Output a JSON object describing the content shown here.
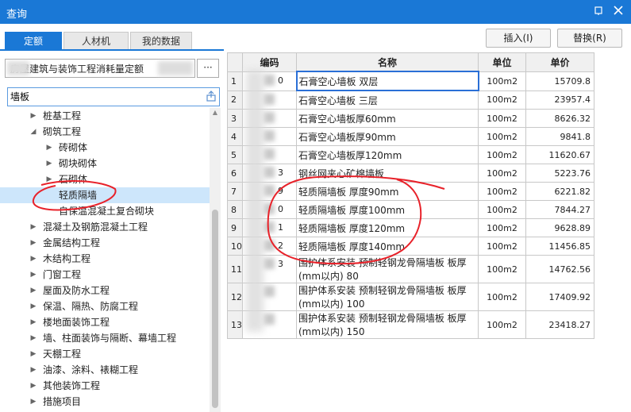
{
  "window": {
    "title": "查询",
    "pin_icon": "pin-icon",
    "close_icon": "close-icon"
  },
  "tabs": [
    {
      "label": "定额",
      "active": true
    },
    {
      "label": "人材机",
      "active": false
    },
    {
      "label": "我的数据",
      "active": false
    }
  ],
  "buttons": {
    "insert": "插入(I)",
    "replace": "替换(R)"
  },
  "library": {
    "text": "房屋建筑与装饰工程消耗量定额",
    "more": "···"
  },
  "search": {
    "value": "墙板",
    "icon": "export-icon"
  },
  "tree": [
    {
      "label": "桩基工程",
      "level": 1,
      "arrow": "▶"
    },
    {
      "label": "砌筑工程",
      "level": 1,
      "arrow": "◢"
    },
    {
      "label": "砖砌体",
      "level": 2,
      "arrow": "▶"
    },
    {
      "label": "砌块砌体",
      "level": 2,
      "arrow": "▶"
    },
    {
      "label": "石砌体",
      "level": 2,
      "arrow": "▶"
    },
    {
      "label": "轻质隔墙",
      "level": 2,
      "arrow": "",
      "selected": true
    },
    {
      "label": "自保温混凝土复合砌块",
      "level": 2,
      "arrow": ""
    },
    {
      "label": "混凝土及钢筋混凝土工程",
      "level": 1,
      "arrow": "▶"
    },
    {
      "label": "金属结构工程",
      "level": 1,
      "arrow": "▶"
    },
    {
      "label": "木结构工程",
      "level": 1,
      "arrow": "▶"
    },
    {
      "label": "门窗工程",
      "level": 1,
      "arrow": "▶"
    },
    {
      "label": "屋面及防水工程",
      "level": 1,
      "arrow": "▶"
    },
    {
      "label": "保温、隔热、防腐工程",
      "level": 1,
      "arrow": "▶"
    },
    {
      "label": "楼地面装饰工程",
      "level": 1,
      "arrow": "▶"
    },
    {
      "label": "墙、柱面装饰与隔断、幕墙工程",
      "level": 1,
      "arrow": "▶"
    },
    {
      "label": "天棚工程",
      "level": 1,
      "arrow": "▶"
    },
    {
      "label": "油漆、涂料、裱糊工程",
      "level": 1,
      "arrow": "▶"
    },
    {
      "label": "其他装饰工程",
      "level": 1,
      "arrow": "▶"
    },
    {
      "label": "措施项目",
      "level": 1,
      "arrow": "▶"
    }
  ],
  "table": {
    "headers": [
      "",
      "编码",
      "名称",
      "单位",
      "单价"
    ],
    "rows": [
      {
        "no": "1",
        "code": "0",
        "name": "石膏空心墙板 双层",
        "unit": "100m2",
        "price": "15709.8",
        "selected": true
      },
      {
        "no": "2",
        "code": "",
        "name": "石膏空心墙板 三层",
        "unit": "100m2",
        "price": "23957.4"
      },
      {
        "no": "3",
        "code": "",
        "name": "石膏空心墙板厚60mm",
        "unit": "100m2",
        "price": "8626.32"
      },
      {
        "no": "4",
        "code": "",
        "name": "石膏空心墙板厚90mm",
        "unit": "100m2",
        "price": "9841.8"
      },
      {
        "no": "5",
        "code": "",
        "name": "石膏空心墙板厚120mm",
        "unit": "100m2",
        "price": "11620.67"
      },
      {
        "no": "6",
        "code": "3",
        "name": "钢丝网夹心矿棉墙板",
        "unit": "100m2",
        "price": "5223.76"
      },
      {
        "no": "7",
        "code": "9",
        "name": "轻质隔墙板 厚度90mm",
        "unit": "100m2",
        "price": "6221.82"
      },
      {
        "no": "8",
        "code": "0",
        "name": "轻质隔墙板 厚度100mm",
        "unit": "100m2",
        "price": "7844.27"
      },
      {
        "no": "9",
        "code": "1",
        "name": "轻质隔墙板 厚度120mm",
        "unit": "100m2",
        "price": "9628.89"
      },
      {
        "no": "10",
        "code": "2",
        "name": "轻质隔墙板 厚度140mm",
        "unit": "100m2",
        "price": "11456.85"
      },
      {
        "no": "11",
        "code": "3",
        "name": "围护体系安装 预制轻钢龙骨隔墙板 板厚(mm以内) 80",
        "unit": "100m2",
        "price": "14762.56"
      },
      {
        "no": "12",
        "code": "",
        "name": "围护体系安装 预制轻钢龙骨隔墙板 板厚(mm以内) 100",
        "unit": "100m2",
        "price": "17409.92"
      },
      {
        "no": "13",
        "code": "",
        "name": "围护体系安装 预制轻钢龙骨隔墙板 板厚(mm以内) 150",
        "unit": "100m2",
        "price": "23418.27"
      }
    ]
  },
  "colors": {
    "accent": "#1a78d6",
    "annotation": "#e8222a",
    "selected_row": "#cde6fb"
  }
}
